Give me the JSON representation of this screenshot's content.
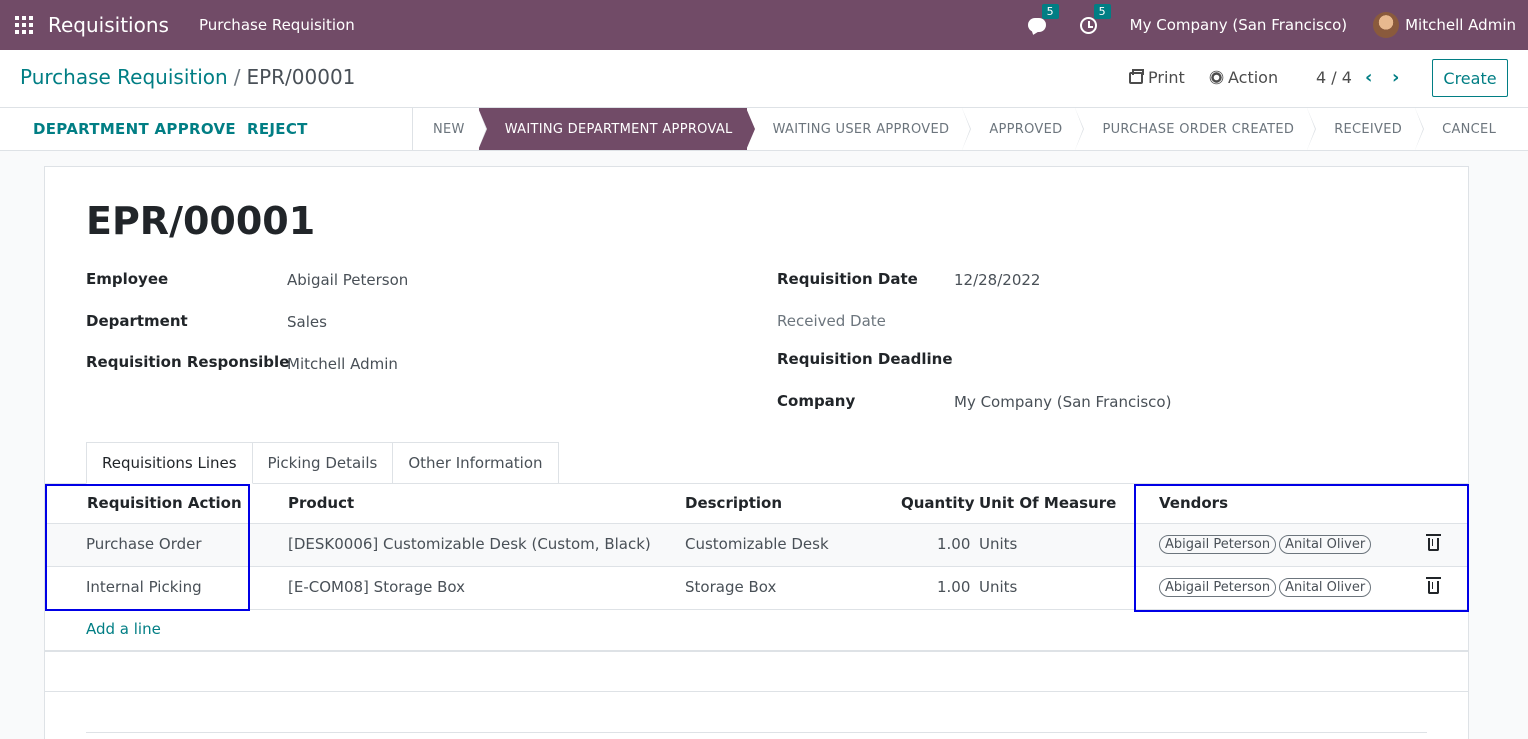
{
  "navbar": {
    "app_name": "Requisitions",
    "menu": "Purchase Requisition",
    "chat_count": "5",
    "activity_count": "5",
    "company": "My Company (San Francisco)",
    "user": "Mitchell Admin"
  },
  "control": {
    "breadcrumb_parent": "Purchase Requisition",
    "breadcrumb_sep": "/",
    "breadcrumb_current": "EPR/00001",
    "print": "Print",
    "action": "Action",
    "pager": "4 / 4",
    "prev": "‹",
    "next": "›",
    "create": "Create"
  },
  "statusbar": {
    "buttons": [
      "DEPARTMENT APPROVE",
      "REJECT"
    ],
    "stages": [
      "NEW",
      "WAITING DEPARTMENT APPROVAL",
      "WAITING USER APPROVED",
      "APPROVED",
      "PURCHASE ORDER CREATED",
      "RECEIVED",
      "CANCEL"
    ],
    "active_stage": "WAITING DEPARTMENT APPROVAL"
  },
  "form": {
    "title": "EPR/00001",
    "left_fields": [
      {
        "label": "Employee",
        "value": "Abigail Peterson"
      },
      {
        "label": "Department",
        "value": "Sales"
      },
      {
        "label": "Requisition Responsible",
        "value": "Mitchell Admin"
      }
    ],
    "right_fields": [
      {
        "label": "Requisition Date",
        "value": "12/28/2022"
      },
      {
        "label": "Received Date",
        "value": ""
      },
      {
        "label": "Requisition Deadline",
        "value": ""
      },
      {
        "label": "Company",
        "value": "My Company (San Francisco)"
      }
    ],
    "tabs": [
      "Requisitions Lines",
      "Picking Details",
      "Other Information"
    ],
    "columns": [
      "Requisition Action",
      "Product",
      "Description",
      "Quantity",
      "Unit Of Measure",
      "Vendors"
    ],
    "rows": [
      {
        "action": "Purchase Order",
        "product": "[DESK0006] Customizable Desk (Custom, Black)",
        "description": "Customizable Desk",
        "quantity": "1.00",
        "uom": "Units",
        "vendors": [
          "Abigail Peterson",
          "Anital Oliver"
        ]
      },
      {
        "action": "Internal Picking",
        "product": "[E-COM08] Storage Box",
        "description": "Storage Box",
        "quantity": "1.00",
        "uom": "Units",
        "vendors": [
          "Abigail Peterson",
          "Anital Oliver"
        ]
      }
    ],
    "add_line": "Add a line"
  },
  "colors": {
    "brand": "#714b67",
    "accent": "#017e84",
    "highlight": "#0000e6"
  }
}
